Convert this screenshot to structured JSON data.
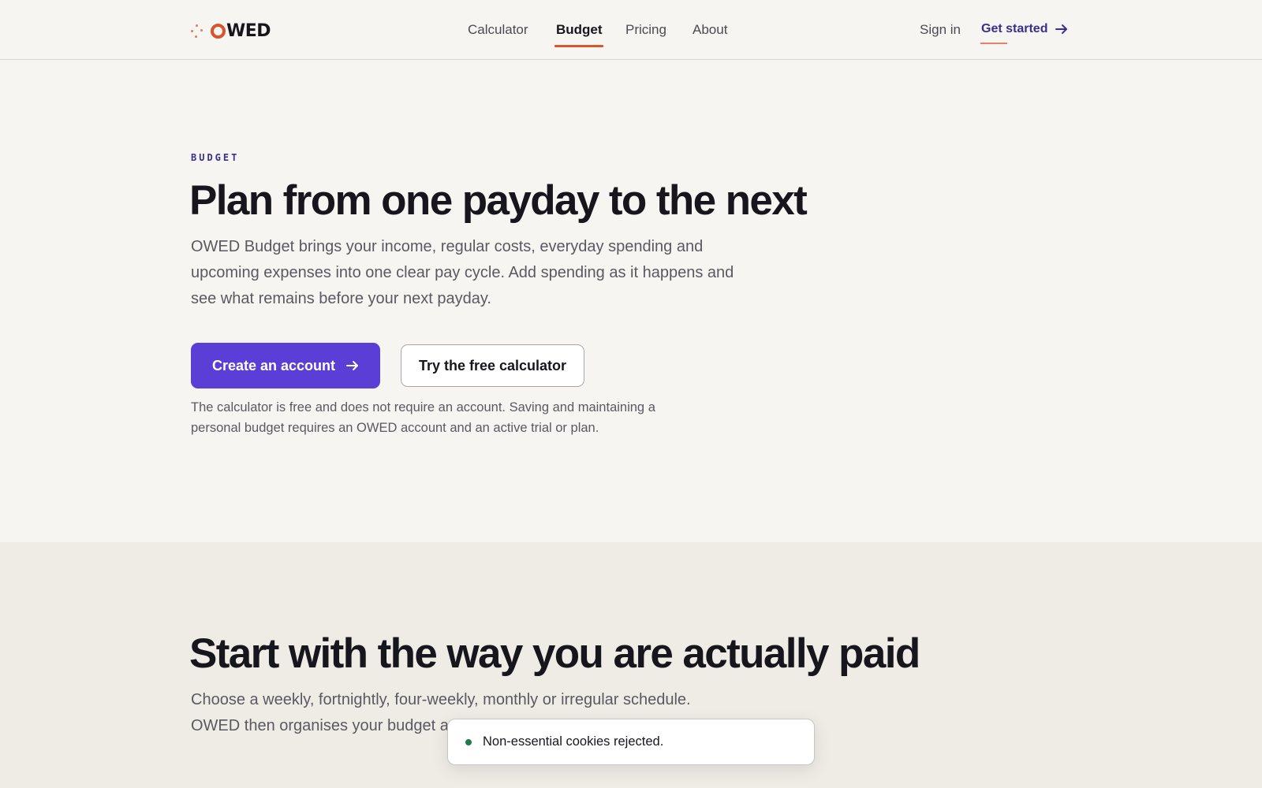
{
  "header": {
    "logo": {
      "text": "WED",
      "icon": "sparkle-dots-icon",
      "o_color": "#d9532d"
    },
    "nav": [
      {
        "label": "Calculator",
        "active": false
      },
      {
        "label": "Budget",
        "active": true
      },
      {
        "label": "Pricing",
        "active": false
      },
      {
        "label": "About",
        "active": false
      }
    ],
    "sign_in": "Sign in",
    "get_started": "Get started",
    "get_started_icon": "arrow-right-icon"
  },
  "hero": {
    "eyebrow": "BUDGET",
    "title": "Plan from one payday to the next",
    "description": "OWED Budget brings your income, regular costs, everyday spending and upcoming expenses into one clear pay cycle. Add spending as it happens and see what remains before your next payday.",
    "primary_button": "Create an account",
    "primary_button_icon": "arrow-right-icon",
    "secondary_button": "Try the free calculator",
    "note": "The calculator is free and does not require an account. Saving and maintaining a personal budget requires an OWED account and an active trial or plan."
  },
  "section2": {
    "title": "Start with the way you are actually paid",
    "description": "Choose a weekly, fortnightly, four-weekly, monthly or irregular schedule. OWED then organises your budget around your next expected payday."
  },
  "toast": {
    "message": "Non-essential cookies rejected.",
    "status_color": "#1f7a4a"
  },
  "colors": {
    "accent": "#5b3ed6",
    "brand_orange": "#d9532d",
    "link_purple": "#3a2f8c",
    "background": "#f6f5f1",
    "section_background": "#efece6"
  }
}
